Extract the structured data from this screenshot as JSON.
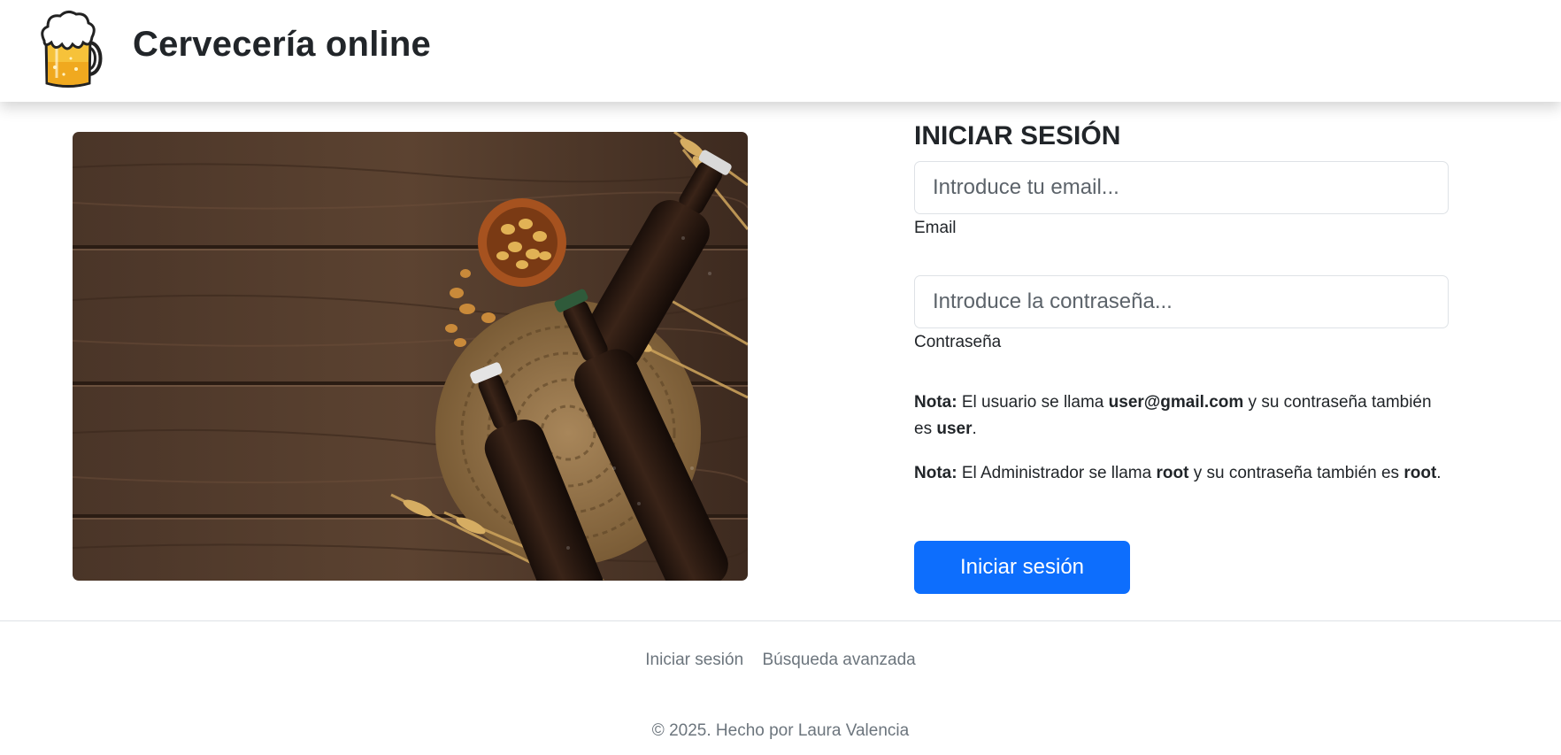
{
  "header": {
    "brand": "Cervecería online",
    "logo_icon": "beer-mug-icon"
  },
  "hero_image": {
    "icon": "beer-bottles-photo"
  },
  "login": {
    "title": "INICIAR SESIÓN",
    "email_placeholder": "Introduce tu email...",
    "email_value": "",
    "email_label": "Email",
    "password_placeholder": "Introduce la contraseña...",
    "password_value": "",
    "password_label": "Contraseña",
    "note1": {
      "prefix": "Nota:",
      "text_a": " El usuario se llama ",
      "user": "user@gmail.com",
      "text_b": " y su contraseña también es ",
      "user_pass": "user",
      "end": "."
    },
    "note2": {
      "prefix": "Nota:",
      "text_a": " El Administrador se llama ",
      "admin": "root",
      "text_b": " y su contraseña también es ",
      "admin_pass": "root",
      "end": "."
    },
    "submit_label": "Iniciar sesión",
    "button_color": "#0d6efd"
  },
  "footer": {
    "links": [
      "Iniciar sesión",
      "Búsqueda avanzada"
    ],
    "copyright": "© 2025. Hecho por Laura Valencia"
  }
}
